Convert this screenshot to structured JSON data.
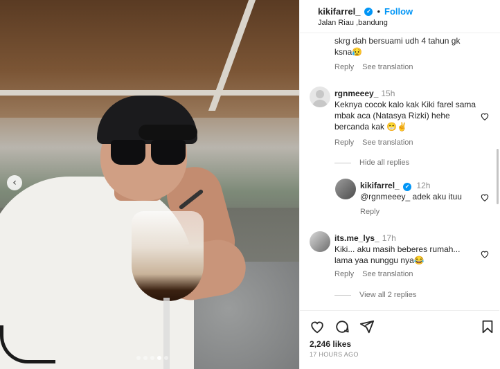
{
  "header": {
    "username": "kikifarrel_",
    "verified_icon": "verified-badge-icon",
    "separator": "•",
    "follow_label": "Follow",
    "location": "Jalan Riau ,bandung"
  },
  "comments": [
    {
      "text": "skrg dah bersuami udh 4 tahun gk ksna😥",
      "reply_label": "Reply",
      "translate_label": "See translation"
    },
    {
      "username": "rgnmeeey_",
      "time": "15h",
      "text": "Keknya cocok kalo kak Kiki farel sama mbak aca (Natasya Rizki) hehe bercanda kak 😁✌️",
      "reply_label": "Reply",
      "translate_label": "See translation"
    },
    {
      "hide_label": "Hide all replies"
    },
    {
      "username": "kikifarrel_",
      "time": "12h",
      "text": "@rgnmeeey_ adek aku ituu",
      "reply_label": "Reply"
    },
    {
      "username": "its.me_lys_",
      "time": "17h",
      "text": "Kiki... aku masih beberes rumah... lama yaa nunggu nya😂",
      "reply_label": "Reply",
      "translate_label": "See translation"
    },
    {
      "view_replies_label": "View all 2 replies"
    }
  ],
  "actions": {
    "icons": [
      "heart-icon",
      "comment-icon",
      "share-icon",
      "bookmark-icon"
    ],
    "likes": "2,246 likes",
    "timestamp": "17 HOURS AGO"
  },
  "carousel": {
    "arrow_icon": "chevron-left-icon",
    "arrow_glyph": "‹",
    "dot_count": 5,
    "active_index": 3
  },
  "colors": {
    "accent": "#0095f6",
    "text": "#262626",
    "muted": "#737373"
  }
}
